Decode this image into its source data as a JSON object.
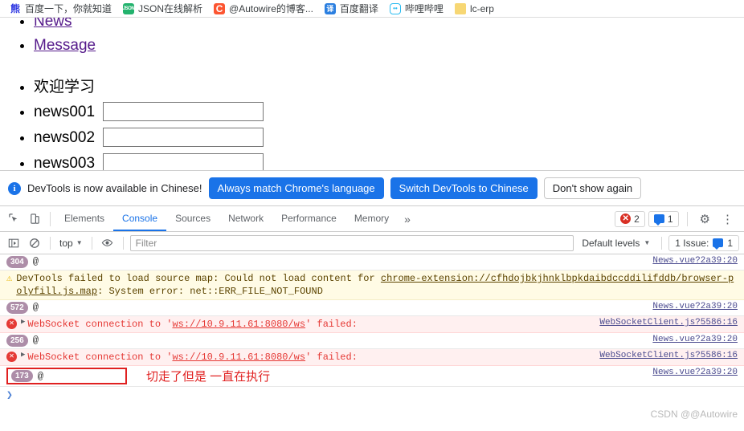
{
  "bookmarks": [
    {
      "label": "百度一下，你就知道",
      "icon": "baidu-favicon",
      "glyph": "熊",
      "style": "fav-baidu"
    },
    {
      "label": "JSON在线解析",
      "icon": "json-favicon",
      "glyph": "JSON",
      "style": "fav-json"
    },
    {
      "label": "@Autowire的博客...",
      "icon": "csdn-favicon",
      "glyph": "C",
      "style": "fav-csdn"
    },
    {
      "label": "百度翻译",
      "icon": "fanyi-favicon",
      "glyph": "译",
      "style": "fav-fanyi"
    },
    {
      "label": "哔哩哔哩",
      "icon": "bilibili-favicon",
      "glyph": "••",
      "style": "fav-bili"
    },
    {
      "label": "lc-erp",
      "icon": "folder-icon",
      "glyph": "",
      "style": "fav-folder"
    }
  ],
  "page": {
    "links": [
      {
        "label": "News"
      },
      {
        "label": "Message"
      }
    ],
    "welcome": "欢迎学习",
    "news_rows": [
      {
        "label": "news001",
        "value": "",
        "placeholder": ""
      },
      {
        "label": "news002",
        "value": "",
        "placeholder": ""
      },
      {
        "label": "news003",
        "value": "",
        "placeholder": ""
      }
    ]
  },
  "devtools": {
    "infobar": {
      "message": "DevTools is now available in Chinese!",
      "primary_button": "Always match Chrome's language",
      "secondary_button": "Switch DevTools to Chinese",
      "dismiss_button": "Don't show again"
    },
    "tabs": [
      {
        "label": "Elements",
        "active": false
      },
      {
        "label": "Console",
        "active": true
      },
      {
        "label": "Sources",
        "active": false
      },
      {
        "label": "Network",
        "active": false
      },
      {
        "label": "Performance",
        "active": false
      },
      {
        "label": "Memory",
        "active": false
      }
    ],
    "more_tabs_glyph": "»",
    "error_count": "2",
    "message_count": "1",
    "console_toolbar": {
      "context": "top",
      "filter_placeholder": "Filter",
      "filter_value": "",
      "levels": "Default levels",
      "issue_label": "1 Issue:",
      "issue_count": "1"
    },
    "messages": [
      {
        "type": "count",
        "badge": "304",
        "text": "@",
        "source": "News.vue?2a39:20"
      },
      {
        "type": "warn",
        "text_parts": [
          {
            "t": "DevTools failed to load source map: Could not load content for ",
            "link": false
          },
          {
            "t": "chrome-extension://cfhdojbkjhnklbpkdaibdccddilifddb/browser-polyfill.js.map",
            "link": true
          },
          {
            "t": ": System error: net::ERR_FILE_NOT_FOUND",
            "link": false
          }
        ],
        "source": ""
      },
      {
        "type": "count",
        "badge": "572",
        "text": "@",
        "source": "News.vue?2a39:20"
      },
      {
        "type": "error",
        "text_parts": [
          {
            "t": "WebSocket connection to '",
            "link": false
          },
          {
            "t": "ws://10.9.11.61:8080/ws",
            "link": true
          },
          {
            "t": "' failed: ",
            "link": false
          }
        ],
        "source": "WebSocketClient.js?5586:16"
      },
      {
        "type": "count",
        "badge": "256",
        "text": "@",
        "source": "News.vue?2a39:20"
      },
      {
        "type": "error",
        "text_parts": [
          {
            "t": "WebSocket connection to '",
            "link": false
          },
          {
            "t": "ws://10.9.11.61:8080/ws",
            "link": true
          },
          {
            "t": "' failed: ",
            "link": false
          }
        ],
        "source": "WebSocketClient.js?5586:16"
      },
      {
        "type": "count-highlighted",
        "badge": "173",
        "text": "@",
        "annotation": "切走了但是 一直在执行",
        "source": "News.vue?2a39:20"
      }
    ],
    "prompt_caret": "❯",
    "watermark": "CSDN @@Autowire"
  }
}
